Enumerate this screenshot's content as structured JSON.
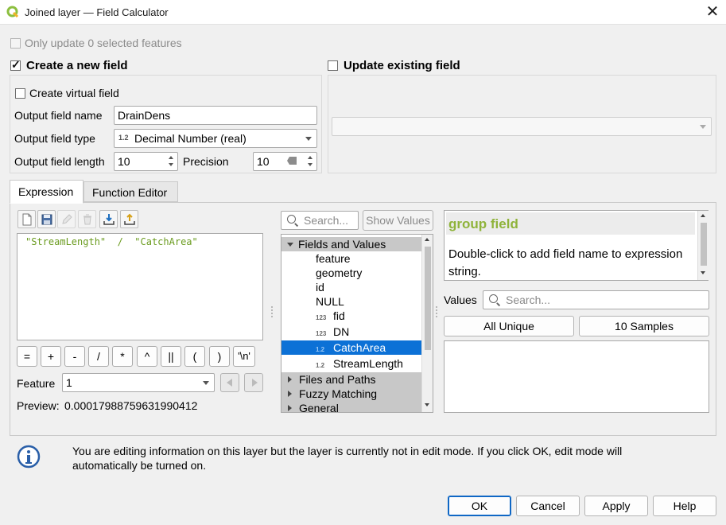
{
  "window": {
    "title": "Joined layer — Field Calculator"
  },
  "top": {
    "only_update_label": "Only update 0 selected features",
    "create_new_field_label": "Create a new field",
    "update_existing_label": "Update existing field",
    "create_virtual_label": "Create virtual field"
  },
  "new_field": {
    "output_name_label": "Output field name",
    "output_name_value": "DrainDens",
    "output_type_label": "Output field type",
    "output_type_icon": "1.2",
    "output_type_value": "Decimal Number (real)",
    "output_length_label": "Output field length",
    "output_length_value": "10",
    "precision_label": "Precision",
    "precision_value": "10"
  },
  "tabs": {
    "expression": "Expression",
    "function_editor": "Function Editor"
  },
  "expression": {
    "text": "\"StreamLength\"  /  \"CatchArea\""
  },
  "operators": [
    "=",
    "+",
    "-",
    "/",
    "*",
    "^",
    "||",
    "(",
    ")",
    "'\\n'"
  ],
  "feature": {
    "label": "Feature",
    "value": "1"
  },
  "preview": {
    "label": "Preview:",
    "value": "0.00017988759631990412"
  },
  "functions": {
    "search_placeholder": "Search...",
    "show_values_label": "Show Values",
    "tree": [
      {
        "type": "group",
        "label": "Fields and Values",
        "expanded": true
      },
      {
        "type": "item",
        "icon": "",
        "label": "feature"
      },
      {
        "type": "item",
        "icon": "",
        "label": "geometry"
      },
      {
        "type": "item",
        "icon": "",
        "label": "id"
      },
      {
        "type": "item",
        "icon": "",
        "label": "NULL"
      },
      {
        "type": "item",
        "icon": "123",
        "label": "fid"
      },
      {
        "type": "item",
        "icon": "123",
        "label": "DN"
      },
      {
        "type": "item",
        "icon": "1.2",
        "label": "CatchArea",
        "selected": true
      },
      {
        "type": "item",
        "icon": "1.2",
        "label": "StreamLength"
      },
      {
        "type": "group",
        "label": "Files and Paths",
        "expanded": false
      },
      {
        "type": "group",
        "label": "Fuzzy Matching",
        "expanded": false
      },
      {
        "type": "group",
        "label": "General",
        "expanded": false
      }
    ]
  },
  "help": {
    "title": "group field",
    "body": "Double-click to add field name to expression string."
  },
  "values": {
    "label": "Values",
    "search_placeholder": "Search...",
    "all_unique_label": "All Unique",
    "samples_label": "10 Samples"
  },
  "info": {
    "message": "You are editing information on this layer but the layer is currently not in edit mode. If you click OK, edit mode will automatically be turned on."
  },
  "buttons": {
    "ok": "OK",
    "cancel": "Cancel",
    "apply": "Apply",
    "help": "Help"
  },
  "colors": {
    "accent": "#0c71d6",
    "help_title": "#8fb33a",
    "expression_text": "#6a9b1e"
  }
}
